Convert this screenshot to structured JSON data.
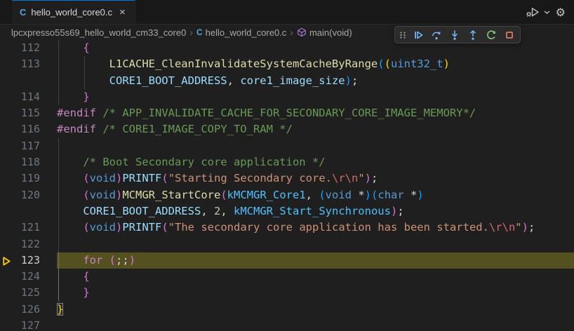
{
  "tab": {
    "title": "hello_world_core0.c",
    "close_glyph": "×",
    "language_icon": "C"
  },
  "editor_actions": {
    "run_or_debug": "run-or-debug",
    "settings_glyph": "⚙"
  },
  "breadcrumb": {
    "separator": "›",
    "project": "lpcxpresso55s69_hello_world_cm33_core0",
    "file": "hello_world_core0.c",
    "symbol": "main(void)"
  },
  "debug_toolbar": {
    "buttons": [
      "gripper",
      "continue",
      "step-over",
      "step-into",
      "step-out",
      "restart",
      "stop"
    ]
  },
  "colors": {
    "accent_tab_border": "#0078d4",
    "debug_line_highlight": "#545020",
    "debug_arrow": "#ffcc00",
    "toolbar_blue": "#75BEFF",
    "toolbar_green": "#89D185",
    "toolbar_red": "#F48771"
  },
  "editor": {
    "rows": [
      {
        "num": "112",
        "guides": [
          {
            "col": 0
          }
        ],
        "tokens": [
          {
            "t": "    ",
            "c": "fg"
          },
          {
            "t": "{",
            "c": "b2"
          }
        ]
      },
      {
        "num": "113",
        "guides": [
          {
            "col": 0
          },
          {
            "col": 1
          }
        ],
        "tokens": [
          {
            "t": "        ",
            "c": "fg"
          },
          {
            "t": "L1CACHE_CleanInvalidateSystemCacheByRange",
            "c": "fn"
          },
          {
            "t": "(",
            "c": "b3"
          },
          {
            "t": "(",
            "c": "b1"
          },
          {
            "t": "uint32_t",
            "c": "type"
          },
          {
            "t": ")",
            "c": "b1"
          }
        ]
      },
      {
        "num": "",
        "guides": [
          {
            "col": 0
          },
          {
            "col": 1
          }
        ],
        "tokens": [
          {
            "t": "        ",
            "c": "fg"
          },
          {
            "t": "CORE1_BOOT_ADDRESS",
            "c": "var"
          },
          {
            "t": ", ",
            "c": "fg"
          },
          {
            "t": "core1_image_size",
            "c": "var"
          },
          {
            "t": ")",
            "c": "b3"
          },
          {
            "t": ";",
            "c": "fg"
          }
        ]
      },
      {
        "num": "114",
        "guides": [
          {
            "col": 0
          }
        ],
        "tokens": [
          {
            "t": "    ",
            "c": "fg"
          },
          {
            "t": "}",
            "c": "b2"
          }
        ]
      },
      {
        "num": "115",
        "guides": [],
        "tokens": [
          {
            "t": "#endif",
            "c": "kw"
          },
          {
            "t": " ",
            "c": "fg"
          },
          {
            "t": "/* APP_INVALIDATE_CACHE_FOR_SECONDARY_CORE_IMAGE_MEMORY*/",
            "c": "comment"
          }
        ]
      },
      {
        "num": "116",
        "guides": [],
        "tokens": [
          {
            "t": "#endif",
            "c": "kw"
          },
          {
            "t": " ",
            "c": "fg"
          },
          {
            "t": "/* CORE1_IMAGE_COPY_TO_RAM */",
            "c": "comment"
          }
        ]
      },
      {
        "num": "117",
        "guides": [
          {
            "col": 0
          }
        ],
        "tokens": []
      },
      {
        "num": "118",
        "guides": [
          {
            "col": 0
          }
        ],
        "tokens": [
          {
            "t": "    ",
            "c": "fg"
          },
          {
            "t": "/* Boot Secondary core application */",
            "c": "comment"
          }
        ]
      },
      {
        "num": "119",
        "guides": [
          {
            "col": 0
          }
        ],
        "tokens": [
          {
            "t": "    ",
            "c": "fg"
          },
          {
            "t": "(",
            "c": "b2"
          },
          {
            "t": "void",
            "c": "type"
          },
          {
            "t": ")",
            "c": "b2"
          },
          {
            "t": "PRINTF",
            "c": "var"
          },
          {
            "t": "(",
            "c": "b2"
          },
          {
            "t": "\"Starting Secondary core.",
            "c": "str"
          },
          {
            "t": "\\r\\n",
            "c": "esc"
          },
          {
            "t": "\"",
            "c": "str"
          },
          {
            "t": ")",
            "c": "b2"
          },
          {
            "t": ";",
            "c": "fg"
          }
        ]
      },
      {
        "num": "120",
        "guides": [
          {
            "col": 0
          }
        ],
        "tokens": [
          {
            "t": "    ",
            "c": "fg"
          },
          {
            "t": "(",
            "c": "b2"
          },
          {
            "t": "void",
            "c": "type"
          },
          {
            "t": ")",
            "c": "b2"
          },
          {
            "t": "MCMGR_StartCore",
            "c": "fn"
          },
          {
            "t": "(",
            "c": "b2"
          },
          {
            "t": "kMCMGR_Core1",
            "c": "enum"
          },
          {
            "t": ", ",
            "c": "fg"
          },
          {
            "t": "(",
            "c": "b3"
          },
          {
            "t": "void",
            "c": "type"
          },
          {
            "t": " *",
            "c": "fg"
          },
          {
            "t": ")",
            "c": "b3"
          },
          {
            "t": "(",
            "c": "b3"
          },
          {
            "t": "char",
            "c": "type"
          },
          {
            "t": " *",
            "c": "fg"
          },
          {
            "t": ")",
            "c": "b3"
          }
        ]
      },
      {
        "num": "",
        "guides": [
          {
            "col": 0
          }
        ],
        "tokens": [
          {
            "t": "    ",
            "c": "fg"
          },
          {
            "t": "CORE1_BOOT_ADDRESS",
            "c": "var"
          },
          {
            "t": ", ",
            "c": "fg"
          },
          {
            "t": "2",
            "c": "num"
          },
          {
            "t": ", ",
            "c": "fg"
          },
          {
            "t": "kMCMGR_Start_Synchronous",
            "c": "enum"
          },
          {
            "t": ")",
            "c": "b2"
          },
          {
            "t": ";",
            "c": "fg"
          }
        ]
      },
      {
        "num": "121",
        "guides": [
          {
            "col": 0
          }
        ],
        "tokens": [
          {
            "t": "    ",
            "c": "fg"
          },
          {
            "t": "(",
            "c": "b2"
          },
          {
            "t": "void",
            "c": "type"
          },
          {
            "t": ")",
            "c": "b2"
          },
          {
            "t": "PRINTF",
            "c": "var"
          },
          {
            "t": "(",
            "c": "b2"
          },
          {
            "t": "\"The secondary core application has been started.",
            "c": "str"
          },
          {
            "t": "\\r\\n",
            "c": "esc"
          },
          {
            "t": "\"",
            "c": "str"
          },
          {
            "t": ")",
            "c": "b2"
          },
          {
            "t": ";",
            "c": "fg"
          }
        ]
      },
      {
        "num": "122",
        "guides": [
          {
            "col": 0
          }
        ],
        "tokens": []
      },
      {
        "num": "123",
        "hl": true,
        "arrow": true,
        "guides": [
          {
            "col": 0,
            "active": true
          }
        ],
        "tokens": [
          {
            "t": "    ",
            "c": "fg"
          },
          {
            "t": "for",
            "c": "kw"
          },
          {
            "t": " ",
            "c": "fg"
          },
          {
            "t": "(",
            "c": "b2"
          },
          {
            "t": ";;",
            "c": "fg"
          },
          {
            "t": ")",
            "c": "b2"
          }
        ]
      },
      {
        "num": "124",
        "guides": [
          {
            "col": 0,
            "active": true
          }
        ],
        "tokens": [
          {
            "t": "    ",
            "c": "fg"
          },
          {
            "t": "{",
            "c": "b2"
          }
        ]
      },
      {
        "num": "125",
        "guides": [
          {
            "col": 0,
            "active": true
          }
        ],
        "tokens": [
          {
            "t": "    ",
            "c": "fg"
          },
          {
            "t": "}",
            "c": "b2"
          }
        ]
      },
      {
        "num": "126",
        "guides": [],
        "tokens": [
          {
            "t": "}",
            "c": "b1",
            "box": true
          }
        ]
      },
      {
        "num": "127",
        "guides": [],
        "tokens": []
      }
    ]
  }
}
